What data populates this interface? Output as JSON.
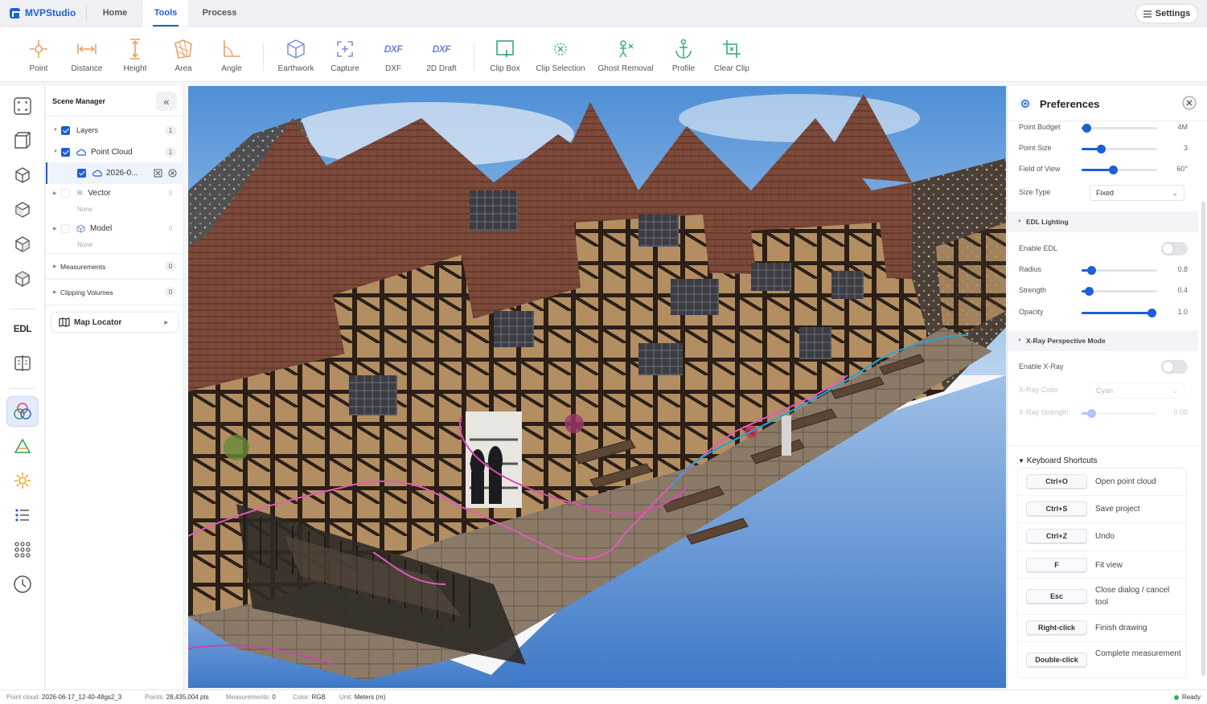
{
  "app": {
    "name": "MVPStudio"
  },
  "nav": {
    "tabs": [
      "Home",
      "Tools",
      "Process"
    ],
    "active": "Tools",
    "settings": "Settings"
  },
  "toolbar": {
    "tools": [
      {
        "label": "Point",
        "icon": "point-icon"
      },
      {
        "label": "Distance",
        "icon": "distance-icon"
      },
      {
        "label": "Height",
        "icon": "height-icon"
      },
      {
        "label": "Area",
        "icon": "area-icon"
      },
      {
        "label": "Angle",
        "icon": "angle-icon"
      },
      {
        "label": "Earthwork",
        "icon": "cube-icon"
      },
      {
        "label": "Capture",
        "icon": "capture-icon"
      },
      {
        "label": "DXF",
        "icon": "dxf-icon",
        "glyph": "DXF"
      },
      {
        "label": "2D Draft",
        "icon": "dxf-icon",
        "glyph": "DXF"
      },
      {
        "label": "Clip Box",
        "icon": "clip-box-icon"
      },
      {
        "label": "Clip Selection",
        "icon": "clip-selection-icon"
      },
      {
        "label": "Ghost Removal",
        "icon": "ghost-removal-icon"
      },
      {
        "label": "Profile",
        "icon": "anchor-icon"
      },
      {
        "label": "Clear Clip",
        "icon": "clear-clip-icon"
      }
    ]
  },
  "rail": {
    "items": [
      "fit-view-icon",
      "perspective-cube-icon",
      "top-view-icon",
      "front-view-icon",
      "left-view-icon",
      "right-view-icon",
      "edl-icon",
      "split-view-icon",
      "color-circles-icon",
      "triangle-icon",
      "sun-icon",
      "list-icon",
      "grid-dots-icon",
      "clock-icon"
    ],
    "edl_label": "EDL"
  },
  "scene_manager": {
    "title": "Scene Manager",
    "layers": {
      "label": "Layers",
      "count": "1"
    },
    "point_cloud": {
      "label": "Point Cloud",
      "count": "1"
    },
    "cloud_item": {
      "label": "2026-0..."
    },
    "vector": {
      "label": "Vector",
      "count": "0",
      "empty": "None"
    },
    "model": {
      "label": "Model",
      "count": "0",
      "empty": "None"
    },
    "measurements": {
      "label": "Measurements",
      "count": "0"
    },
    "clipping": {
      "label": "Clipping Volumes",
      "count": "0"
    },
    "map_locator": "Map Locator"
  },
  "preferences": {
    "title": "Preferences",
    "point_budget": {
      "label": "Point Budget",
      "value": "4M",
      "level": 0.06
    },
    "point_size": {
      "label": "Point Size",
      "value": "3",
      "level": 0.26
    },
    "field_of_view": {
      "label": "Field of View",
      "value": "60°",
      "level": 0.42
    },
    "size_type": {
      "label": "Size Type",
      "value": "Fixed"
    },
    "edl_section": "EDL Lighting",
    "enable_edl": {
      "label": "Enable EDL"
    },
    "radius": {
      "label": "Radius",
      "value": "0.8",
      "level": 0.13
    },
    "strength": {
      "label": "Strength",
      "value": "0.4",
      "level": 0.1
    },
    "opacity": {
      "label": "Opacity",
      "value": "1.0",
      "level": 0.93
    },
    "xray_section": "X-Ray Perspective Mode",
    "enable_xray": {
      "label": "Enable X-Ray"
    },
    "xray_color": {
      "label": "X-Ray Color",
      "value": "Cyan"
    },
    "xray_strength": {
      "label": "X-Ray Strength",
      "value": "0.08",
      "level": 0.13
    },
    "shortcuts_title": "Keyboard Shortcuts",
    "shortcuts": [
      {
        "key": "Ctrl+O",
        "desc": "Open point cloud"
      },
      {
        "key": "Ctrl+S",
        "desc": "Save project"
      },
      {
        "key": "Ctrl+Z",
        "desc": "Undo"
      },
      {
        "key": "F",
        "desc": "Fit view"
      },
      {
        "key": "Esc",
        "desc": "Close dialog / cancel tool"
      },
      {
        "key": "Right-click",
        "desc": "Finish drawing"
      },
      {
        "key": "Double-click",
        "desc": "Complete measurement"
      }
    ]
  },
  "status": {
    "cloud_label": "Point cloud:",
    "cloud_value": "2026-06-17_12-40-48gs2_3",
    "points_label": "Points:",
    "points_value": "28,435,004 pts",
    "meas_label": "Measurements:",
    "meas_value": "0",
    "color_label": "Color:",
    "color_value": "RGB",
    "unit_label": "Unit:",
    "unit_value": "Meters (m)",
    "ready": "Ready"
  },
  "colors": {
    "accent": "#1c5fd6",
    "tool_icon": "#e8a163",
    "tool_icon_alt": "#7b8fd8",
    "tool_icon_green": "#3aa58a"
  }
}
